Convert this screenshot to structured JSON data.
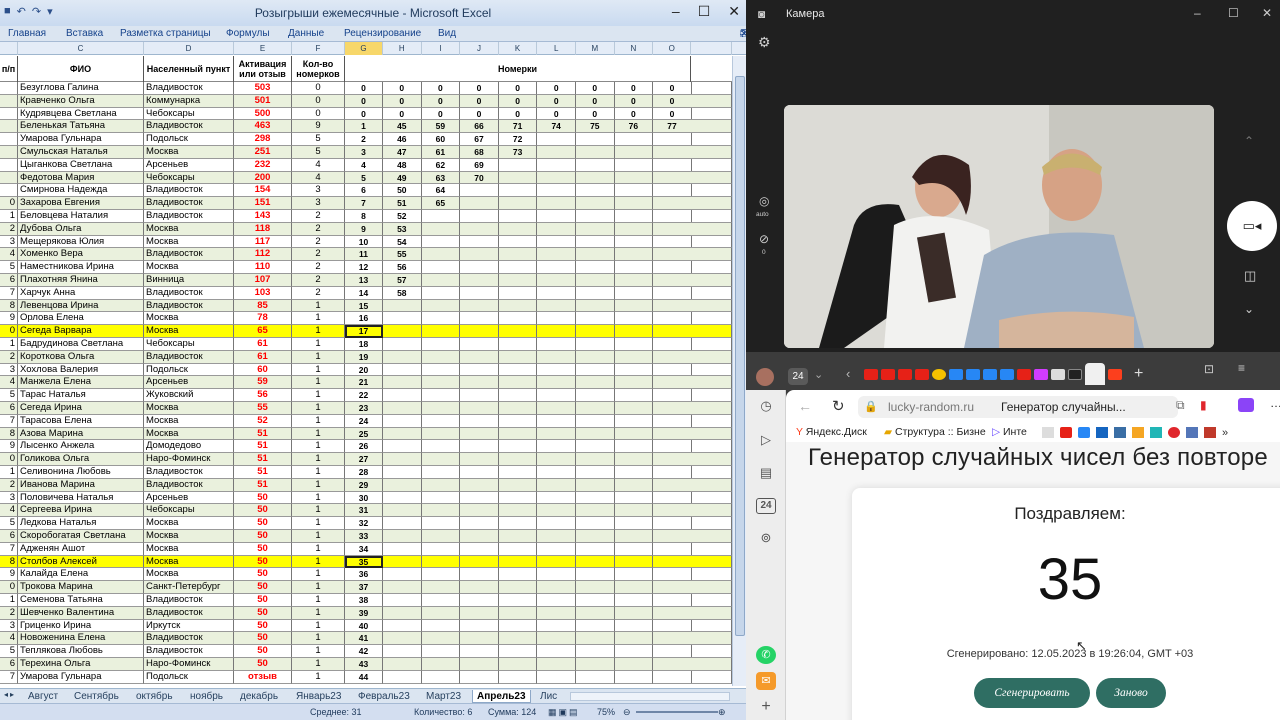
{
  "excel": {
    "title": "Розыгрыши ежемесячные - Microsoft Excel",
    "ribbon": [
      "Главная",
      "Вставка",
      "Разметка страницы",
      "Формулы",
      "Данные",
      "Рецензирование",
      "Вид"
    ],
    "col_letters": [
      "",
      "C",
      "D",
      "E",
      "F",
      "G",
      "H",
      "I",
      "J",
      "K",
      "L",
      "M",
      "N",
      "O",
      ""
    ],
    "headers": {
      "a": "п/п",
      "c": "ФИО",
      "d": "Населенный пункт",
      "e": "Активация или отзыв",
      "f": "Кол-во номерков",
      "nomerki": "Номерки"
    },
    "rows": [
      {
        "a": "",
        "name": "Безуглова Галина",
        "city": "Владивосток",
        "act": "503",
        "cnt": "0",
        "nums": [
          "0",
          "0",
          "0",
          "0",
          "0",
          "0",
          "0",
          "0",
          "0"
        ]
      },
      {
        "a": "",
        "name": "Кравченко Ольга",
        "city": "Коммунарка",
        "act": "501",
        "cnt": "0",
        "nums": [
          "0",
          "0",
          "0",
          "0",
          "0",
          "0",
          "0",
          "0",
          "0"
        ]
      },
      {
        "a": "",
        "name": "Кудрявцева Светлана",
        "city": "Чебоксары",
        "act": "500",
        "cnt": "0",
        "nums": [
          "0",
          "0",
          "0",
          "0",
          "0",
          "0",
          "0",
          "0",
          "0"
        ]
      },
      {
        "a": "",
        "name": "Беленькая Татьяна",
        "city": "Владивосток",
        "act": "463",
        "cnt": "9",
        "nums": [
          "1",
          "45",
          "59",
          "66",
          "71",
          "74",
          "75",
          "76",
          "77"
        ]
      },
      {
        "a": "",
        "name": "Умарова Гульнара",
        "city": "Подольск",
        "act": "298",
        "cnt": "5",
        "nums": [
          "2",
          "46",
          "60",
          "67",
          "72",
          "",
          "",
          "",
          ""
        ]
      },
      {
        "a": "",
        "name": "Смульская Наталья",
        "city": "Москва",
        "act": "251",
        "cnt": "5",
        "nums": [
          "3",
          "47",
          "61",
          "68",
          "73",
          "",
          "",
          "",
          ""
        ]
      },
      {
        "a": "",
        "name": "Цыганкова Светлана",
        "city": "Арсеньев",
        "act": "232",
        "cnt": "4",
        "nums": [
          "4",
          "48",
          "62",
          "69",
          "",
          "",
          "",
          "",
          ""
        ]
      },
      {
        "a": "",
        "name": "Федотова Мария",
        "city": "Чебоксары",
        "act": "200",
        "cnt": "4",
        "nums": [
          "5",
          "49",
          "63",
          "70",
          "",
          "",
          "",
          "",
          ""
        ]
      },
      {
        "a": "",
        "name": "Смирнова Надежда",
        "city": "Владивосток",
        "act": "154",
        "cnt": "3",
        "nums": [
          "6",
          "50",
          "64",
          "",
          "",
          "",
          "",
          "",
          ""
        ]
      },
      {
        "a": "0",
        "name": "Захарова Евгения",
        "city": "Владивосток",
        "act": "151",
        "cnt": "3",
        "nums": [
          "7",
          "51",
          "65",
          "",
          "",
          "",
          "",
          "",
          ""
        ]
      },
      {
        "a": "1",
        "name": "Беловцева Наталия",
        "city": "Владивосток",
        "act": "143",
        "cnt": "2",
        "nums": [
          "8",
          "52",
          "",
          "",
          "",
          "",
          "",
          "",
          ""
        ]
      },
      {
        "a": "2",
        "name": "Дубова Ольга",
        "city": "Москва",
        "act": "118",
        "cnt": "2",
        "nums": [
          "9",
          "53",
          "",
          "",
          "",
          "",
          "",
          "",
          ""
        ]
      },
      {
        "a": "3",
        "name": "Мещерякова Юлия",
        "city": "Москва",
        "act": "117",
        "cnt": "2",
        "nums": [
          "10",
          "54",
          "",
          "",
          "",
          "",
          "",
          "",
          ""
        ]
      },
      {
        "a": "4",
        "name": "Хоменко Вера",
        "city": "Владивосток",
        "act": "112",
        "cnt": "2",
        "nums": [
          "11",
          "55",
          "",
          "",
          "",
          "",
          "",
          "",
          ""
        ]
      },
      {
        "a": "5",
        "name": "Наместникова Ирина",
        "city": "Москва",
        "act": "110",
        "cnt": "2",
        "nums": [
          "12",
          "56",
          "",
          "",
          "",
          "",
          "",
          "",
          ""
        ]
      },
      {
        "a": "6",
        "name": "Плахотняя Янина",
        "city": "Винница",
        "act": "107",
        "cnt": "2",
        "nums": [
          "13",
          "57",
          "",
          "",
          "",
          "",
          "",
          "",
          ""
        ]
      },
      {
        "a": "7",
        "name": "Харчук Анна",
        "city": "Владивосток",
        "act": "103",
        "cnt": "2",
        "nums": [
          "14",
          "58",
          "",
          "",
          "",
          "",
          "",
          "",
          ""
        ]
      },
      {
        "a": "8",
        "name": "Левенцова Ирина",
        "city": "Владивосток",
        "act": "85",
        "cnt": "1",
        "nums": [
          "15",
          "",
          "",
          "",
          "",
          "",
          "",
          "",
          ""
        ]
      },
      {
        "a": "9",
        "name": "Орлова Елена",
        "city": "Москва",
        "act": "78",
        "cnt": "1",
        "nums": [
          "16",
          "",
          "",
          "",
          "",
          "",
          "",
          "",
          ""
        ]
      },
      {
        "a": "0",
        "name": "Сегеда Варвара",
        "city": "Москва",
        "act": "65",
        "cnt": "1",
        "nums": [
          "17",
          "",
          "",
          "",
          "",
          "",
          "",
          "",
          ""
        ]
      },
      {
        "a": "1",
        "name": "Бадрудинова Светлана",
        "city": "Чебоксары",
        "act": "61",
        "cnt": "1",
        "nums": [
          "18",
          "",
          "",
          "",
          "",
          "",
          "",
          "",
          ""
        ]
      },
      {
        "a": "2",
        "name": "Короткова Ольга",
        "city": "Владивосток",
        "act": "61",
        "cnt": "1",
        "nums": [
          "19",
          "",
          "",
          "",
          "",
          "",
          "",
          "",
          ""
        ]
      },
      {
        "a": "3",
        "name": "Хохлова Валерия",
        "city": "Подольск",
        "act": "60",
        "cnt": "1",
        "nums": [
          "20",
          "",
          "",
          "",
          "",
          "",
          "",
          "",
          ""
        ]
      },
      {
        "a": "4",
        "name": "Манжела Елена",
        "city": "Арсеньев",
        "act": "59",
        "cnt": "1",
        "nums": [
          "21",
          "",
          "",
          "",
          "",
          "",
          "",
          "",
          ""
        ]
      },
      {
        "a": "5",
        "name": "Тарас Наталья",
        "city": "Жуковский",
        "act": "56",
        "cnt": "1",
        "nums": [
          "22",
          "",
          "",
          "",
          "",
          "",
          "",
          "",
          ""
        ]
      },
      {
        "a": "6",
        "name": "Сегеда Ирина",
        "city": "Москва",
        "act": "55",
        "cnt": "1",
        "nums": [
          "23",
          "",
          "",
          "",
          "",
          "",
          "",
          "",
          ""
        ]
      },
      {
        "a": "7",
        "name": "Тарасова Елена",
        "city": "Москва",
        "act": "52",
        "cnt": "1",
        "nums": [
          "24",
          "",
          "",
          "",
          "",
          "",
          "",
          "",
          ""
        ]
      },
      {
        "a": "8",
        "name": "Азова Марина",
        "city": "Москва",
        "act": "51",
        "cnt": "1",
        "nums": [
          "25",
          "",
          "",
          "",
          "",
          "",
          "",
          "",
          ""
        ]
      },
      {
        "a": "9",
        "name": "Лысенко Анжела",
        "city": "Домодедово",
        "act": "51",
        "cnt": "1",
        "nums": [
          "26",
          "",
          "",
          "",
          "",
          "",
          "",
          "",
          ""
        ]
      },
      {
        "a": "0",
        "name": "Голикова Ольга",
        "city": "Наро-Фоминск",
        "act": "51",
        "cnt": "1",
        "nums": [
          "27",
          "",
          "",
          "",
          "",
          "",
          "",
          "",
          ""
        ]
      },
      {
        "a": "1",
        "name": "Селивонина Любовь",
        "city": "Владивосток",
        "act": "51",
        "cnt": "1",
        "nums": [
          "28",
          "",
          "",
          "",
          "",
          "",
          "",
          "",
          ""
        ]
      },
      {
        "a": "2",
        "name": "Иванова Марина",
        "city": "Владивосток",
        "act": "51",
        "cnt": "1",
        "nums": [
          "29",
          "",
          "",
          "",
          "",
          "",
          "",
          "",
          ""
        ]
      },
      {
        "a": "3",
        "name": "Половичева Наталья",
        "city": "Арсеньев",
        "act": "50",
        "cnt": "1",
        "nums": [
          "30",
          "",
          "",
          "",
          "",
          "",
          "",
          "",
          ""
        ]
      },
      {
        "a": "4",
        "name": "Сергеева Ирина",
        "city": "Чебоксары",
        "act": "50",
        "cnt": "1",
        "nums": [
          "31",
          "",
          "",
          "",
          "",
          "",
          "",
          "",
          ""
        ]
      },
      {
        "a": "5",
        "name": "Ледкова Наталья",
        "city": "Москва",
        "act": "50",
        "cnt": "1",
        "nums": [
          "32",
          "",
          "",
          "",
          "",
          "",
          "",
          "",
          ""
        ]
      },
      {
        "a": "6",
        "name": "Скоробогатая Светлана",
        "city": "Москва",
        "act": "50",
        "cnt": "1",
        "nums": [
          "33",
          "",
          "",
          "",
          "",
          "",
          "",
          "",
          ""
        ]
      },
      {
        "a": "7",
        "name": "Адженян Ашот",
        "city": "Москва",
        "act": "50",
        "cnt": "1",
        "nums": [
          "34",
          "",
          "",
          "",
          "",
          "",
          "",
          "",
          ""
        ]
      },
      {
        "a": "8",
        "name": "Столбов Алексей",
        "city": "Москва",
        "act": "50",
        "cnt": "1",
        "nums": [
          "35",
          "",
          "",
          "",
          "",
          "",
          "",
          "",
          ""
        ]
      },
      {
        "a": "9",
        "name": "Калайда Елена",
        "city": "Москва",
        "act": "50",
        "cnt": "1",
        "nums": [
          "36",
          "",
          "",
          "",
          "",
          "",
          "",
          "",
          ""
        ]
      },
      {
        "a": "0",
        "name": "Трокова Марина",
        "city": "Санкт-Петербург",
        "act": "50",
        "cnt": "1",
        "nums": [
          "37",
          "",
          "",
          "",
          "",
          "",
          "",
          "",
          ""
        ]
      },
      {
        "a": "1",
        "name": "Семенова Татьяна",
        "city": "Владивосток",
        "act": "50",
        "cnt": "1",
        "nums": [
          "38",
          "",
          "",
          "",
          "",
          "",
          "",
          "",
          ""
        ]
      },
      {
        "a": "2",
        "name": "Шевченко Валентина",
        "city": "Владивосток",
        "act": "50",
        "cnt": "1",
        "nums": [
          "39",
          "",
          "",
          "",
          "",
          "",
          "",
          "",
          ""
        ]
      },
      {
        "a": "3",
        "name": "Гриценко Ирина",
        "city": "Иркутск",
        "act": "50",
        "cnt": "1",
        "nums": [
          "40",
          "",
          "",
          "",
          "",
          "",
          "",
          "",
          ""
        ]
      },
      {
        "a": "4",
        "name": "Новоженина Елена",
        "city": "Владивосток",
        "act": "50",
        "cnt": "1",
        "nums": [
          "41",
          "",
          "",
          "",
          "",
          "",
          "",
          "",
          ""
        ]
      },
      {
        "a": "5",
        "name": "Теплякова Любовь",
        "city": "Владивосток",
        "act": "50",
        "cnt": "1",
        "nums": [
          "42",
          "",
          "",
          "",
          "",
          "",
          "",
          "",
          ""
        ]
      },
      {
        "a": "6",
        "name": "Терехина Ольга",
        "city": "Наро-Фоминск",
        "act": "50",
        "cnt": "1",
        "nums": [
          "43",
          "",
          "",
          "",
          "",
          "",
          "",
          "",
          ""
        ]
      },
      {
        "a": "7",
        "name": "Умарова Гульнара",
        "city": "Подольск",
        "act": "отзыв",
        "cnt": "1",
        "nums": [
          "44",
          "",
          "",
          "",
          "",
          "",
          "",
          "",
          ""
        ]
      }
    ],
    "highlighted_rows": [
      19,
      37
    ],
    "tabs": [
      "Август",
      "Сентябрь",
      "октябрь",
      "ноябрь",
      "декабрь",
      "Январь23",
      "Февраль23",
      "Март23",
      "Апрель23",
      "Лис"
    ],
    "active_tab": "Апрель23",
    "status": {
      "avg": "Среднее: 31",
      "count": "Количество: 6",
      "sum": "Сумма: 124",
      "zoom": "75%"
    }
  },
  "camera": {
    "title": "Камера",
    "auto_label": "auto",
    "zero_label": "0"
  },
  "browser": {
    "tab_count": "24",
    "domain": "lucky-random.ru",
    "page_title": "Генератор случайны...",
    "bookmarks": [
      "Яндекс.Диск",
      "Структура :: Бизне",
      "Инте"
    ],
    "side_badge": "24",
    "heading": "Генератор случайных чисел без повторе",
    "congrats": "Поздравляем:",
    "number": "35",
    "generated": "Сгенерировано: 12.05.2023 в 19:26:04, GMT +03",
    "btn_generate": "Сгенерировать",
    "btn_again": "Заново"
  }
}
